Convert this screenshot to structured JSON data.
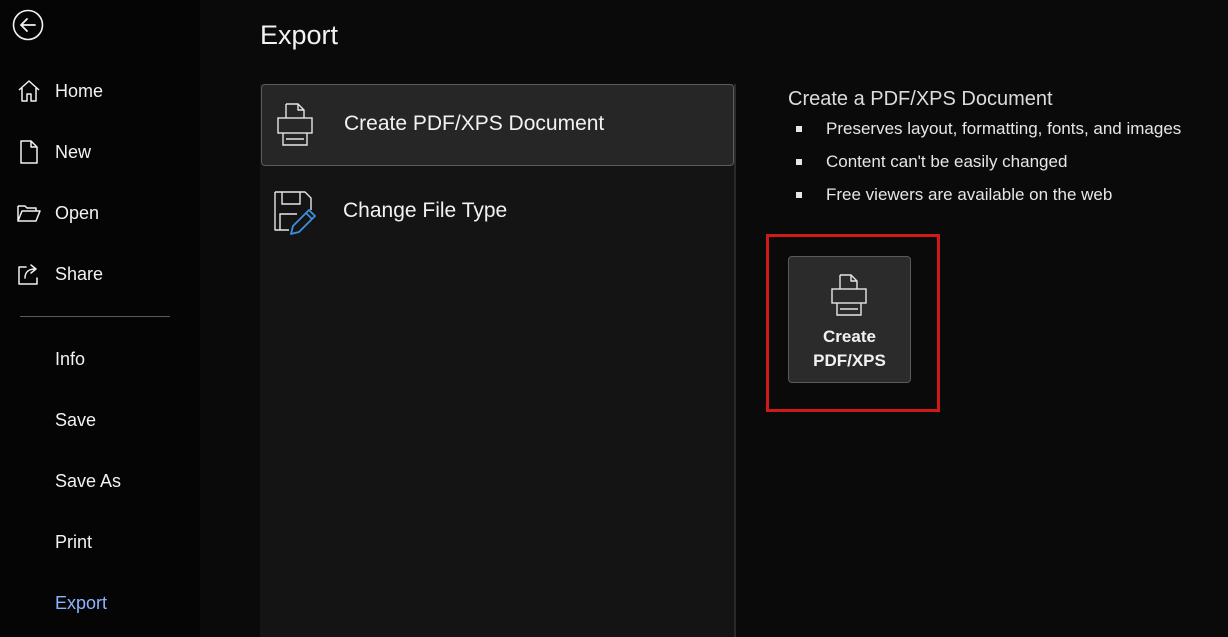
{
  "sidebar": {
    "back_icon": "back-arrow-icon",
    "items": [
      {
        "label": "Home",
        "icon": "home-icon"
      },
      {
        "label": "New",
        "icon": "new-document-icon"
      },
      {
        "label": "Open",
        "icon": "folder-open-icon"
      },
      {
        "label": "Share",
        "icon": "share-icon"
      },
      {
        "label": "Info"
      },
      {
        "label": "Save"
      },
      {
        "label": "Save As"
      },
      {
        "label": "Print"
      },
      {
        "label": "Export",
        "active": true
      }
    ],
    "active_color": "#8fb4ff"
  },
  "main": {
    "title": "Export",
    "options": [
      {
        "label": "Create PDF/XPS Document",
        "icon": "pdf-document-icon",
        "selected": true
      },
      {
        "label": "Change File Type",
        "icon": "change-file-type-icon",
        "selected": false
      }
    ]
  },
  "details": {
    "title": "Create a PDF/XPS Document",
    "bullets": [
      "Preserves layout, formatting, fonts, and images",
      "Content can't be easily changed",
      "Free viewers are available on the web"
    ],
    "button_label": "Create\nPDF/XPS",
    "button_icon": "pdf-document-icon",
    "highlight_color": "#d01919"
  }
}
